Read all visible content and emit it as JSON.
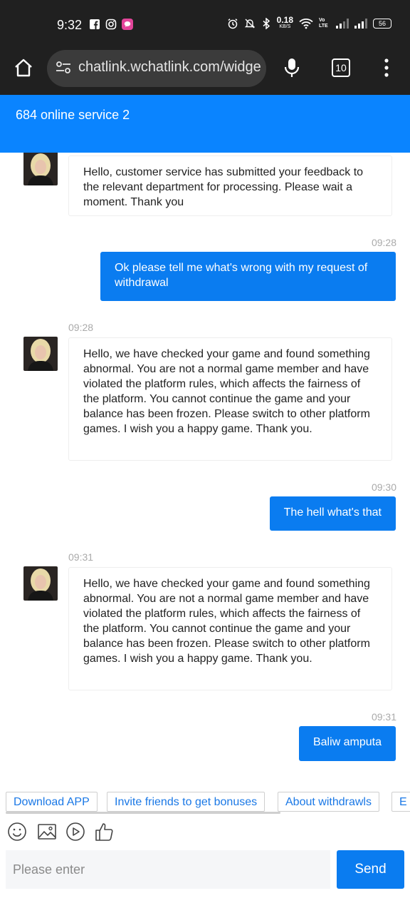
{
  "status_bar": {
    "time": "9:32",
    "speed_value": "0.18",
    "speed_unit": "KB/S",
    "network": "Vo LTE",
    "battery": "56"
  },
  "browser": {
    "url": "chatlink.wchatlink.com/widget",
    "tab_count": "10"
  },
  "header": {
    "title": "684 online service 2"
  },
  "messages": [
    {
      "side": "agent",
      "time": "",
      "text": "Hello, customer service has submitted your feedback to the relevant department for processing. Please wait a moment. Thank you"
    },
    {
      "side": "user",
      "time": "09:28",
      "text": "Ok please tell me what's wrong with my request of withdrawal"
    },
    {
      "side": "agent",
      "time": "09:28",
      "text": "Hello, we have checked your game and found something abnormal. You are not a normal game member and have violated the platform rules, which affects the fairness of the platform. You cannot continue the game and your balance has been frozen. Please switch to other platform games. I wish you a happy game. Thank you."
    },
    {
      "side": "user",
      "time": "09:30",
      "text": "The hell what's that"
    },
    {
      "side": "agent",
      "time": "09:31",
      "text": "Hello, we have checked your game and found something abnormal. You are not a normal game member and have violated the platform rules, which affects the fairness of the platform. You cannot continue the game and your balance has been frozen. Please switch to other platform games. I wish you a happy game. Thank you."
    },
    {
      "side": "user",
      "time": "09:31",
      "text": "Baliw amputa"
    }
  ],
  "quick_replies": [
    "Download APP",
    "Invite friends to get bonuses",
    "About withdrawls",
    "E"
  ],
  "toolbar_icons": [
    "emoji-icon",
    "image-icon",
    "video-icon",
    "thumbs-up-icon"
  ],
  "composer": {
    "placeholder": "Please enter",
    "send_label": "Send"
  },
  "colors": {
    "accent": "#0a84ff",
    "user_bubble": "#0a7cf0",
    "status_bar": "#202020"
  }
}
